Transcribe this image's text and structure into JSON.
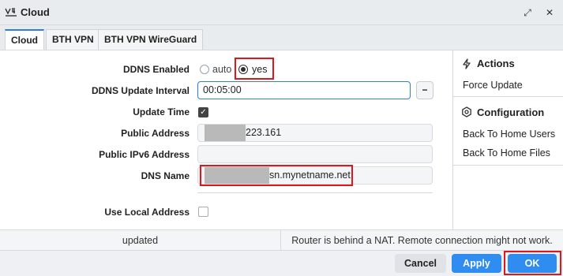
{
  "window": {
    "title": "Cloud",
    "restore_glyph": "⤢",
    "close_glyph": "✕"
  },
  "tabs": [
    {
      "label": "Cloud",
      "active": true
    },
    {
      "label": "BTH VPN",
      "active": false
    },
    {
      "label": "BTH VPN WireGuard",
      "active": false
    }
  ],
  "form": {
    "ddns_enabled": {
      "label": "DDNS Enabled",
      "options": [
        "auto",
        "yes"
      ],
      "selected": "yes"
    },
    "ddns_update_interval": {
      "label": "DDNS Update Interval",
      "value": "00:05:00",
      "button": "−"
    },
    "update_time": {
      "label": "Update Time",
      "checked": true,
      "check_glyph": "✓"
    },
    "public_address": {
      "label": "Public Address",
      "value": "223.161"
    },
    "public_ipv6_address": {
      "label": "Public IPv6 Address",
      "value": ""
    },
    "dns_name": {
      "label": "DNS Name",
      "value": "sn.mynetname.net"
    },
    "use_local_address": {
      "label": "Use Local Address",
      "checked": false
    }
  },
  "sidebar": {
    "actions": {
      "heading": "Actions",
      "icon": "lightning-icon",
      "items": [
        "Force Update"
      ]
    },
    "configuration": {
      "heading": "Configuration",
      "icon": "hexagon-gear-icon",
      "items": [
        "Back To Home Users",
        "Back To Home Files"
      ]
    }
  },
  "status": {
    "left": "updated",
    "right": "Router is behind a NAT. Remote connection might not work."
  },
  "buttons": {
    "cancel": "Cancel",
    "apply": "Apply",
    "ok": "OK"
  },
  "colors": {
    "accent": "#2f8cf0",
    "highlight": "#e0161a"
  }
}
